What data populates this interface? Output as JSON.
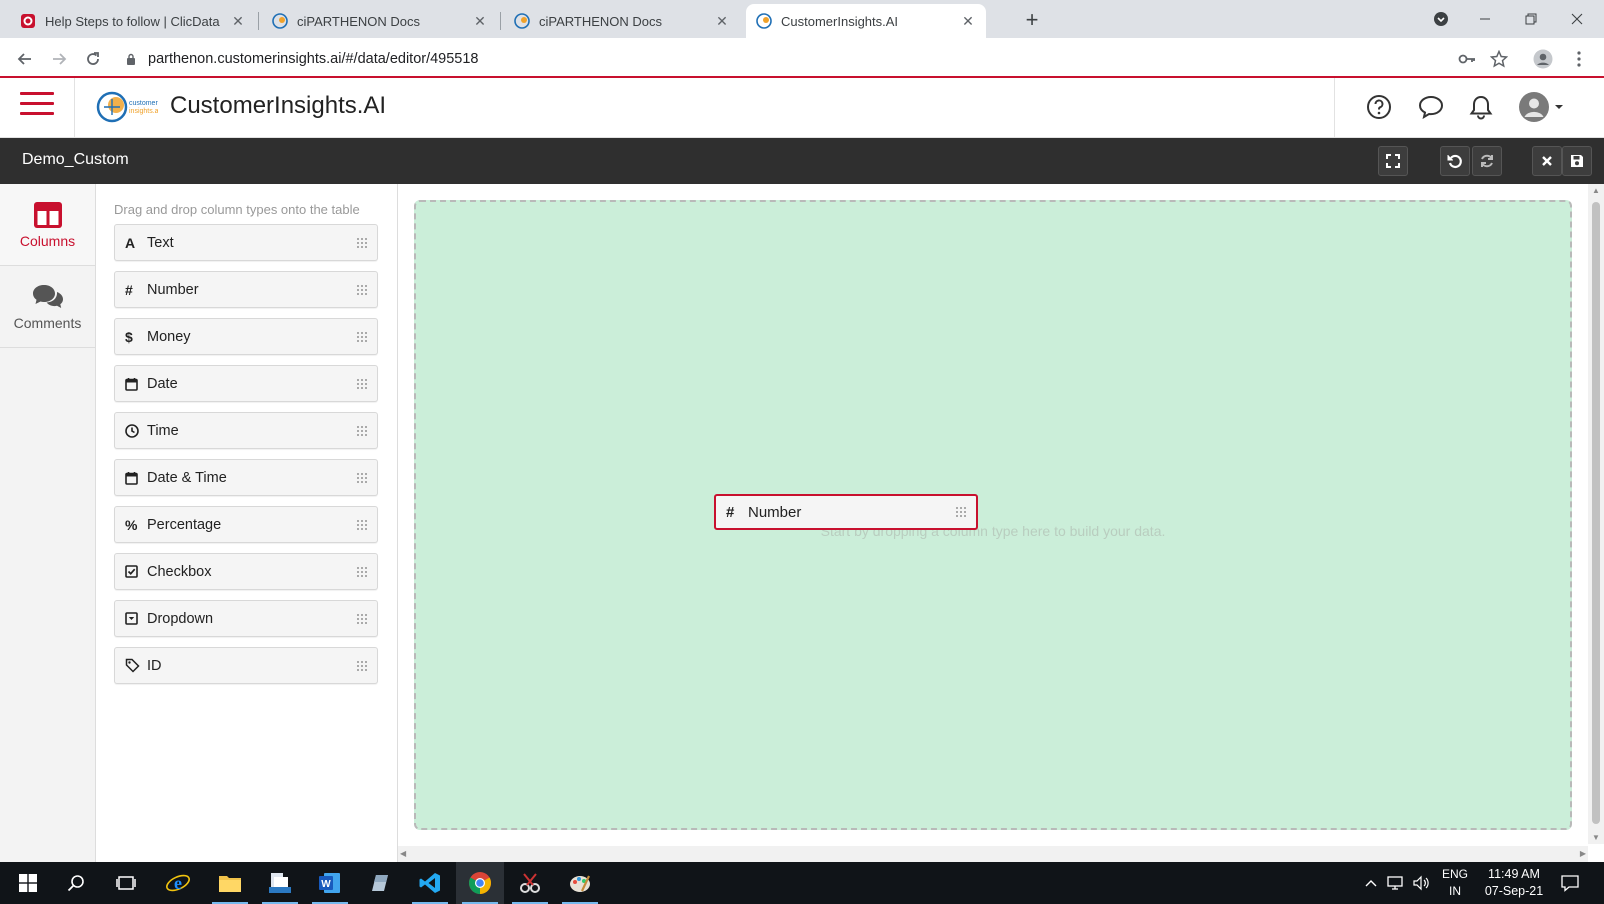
{
  "browser": {
    "tabs": [
      {
        "title": "Help Steps to follow | ClicData",
        "favicon": "clicdata-icon"
      },
      {
        "title": "ciPARTHENON Docs",
        "favicon": "parthenon-icon"
      },
      {
        "title": "ciPARTHENON Docs",
        "favicon": "parthenon-icon"
      },
      {
        "title": "CustomerInsights.AI",
        "favicon": "parthenon-icon",
        "active": true
      }
    ],
    "url": "parthenon.customerinsights.ai/#/data/editor/495518"
  },
  "app": {
    "title": "CustomerInsights.AI",
    "logo_text": "customer insights.ai",
    "accent_color": "#c8102e"
  },
  "toolbar": {
    "document_name": "Demo_Custom"
  },
  "rail": {
    "items": [
      {
        "label": "Columns",
        "icon": "columns-icon",
        "active": true
      },
      {
        "label": "Comments",
        "icon": "comments-icon",
        "active": false
      }
    ]
  },
  "panel": {
    "hint": "Drag and drop column types onto the table",
    "column_types": [
      {
        "label": "Text",
        "icon": "A"
      },
      {
        "label": "Number",
        "icon": "#"
      },
      {
        "label": "Money",
        "icon": "$"
      },
      {
        "label": "Date",
        "icon": "calendar-icon"
      },
      {
        "label": "Time",
        "icon": "clock-icon"
      },
      {
        "label": "Date & Time",
        "icon": "calendar-icon"
      },
      {
        "label": "Percentage",
        "icon": "%"
      },
      {
        "label": "Checkbox",
        "icon": "checkbox-icon"
      },
      {
        "label": "Dropdown",
        "icon": "dropdown-icon"
      },
      {
        "label": "ID",
        "icon": "tag-icon"
      }
    ]
  },
  "canvas": {
    "drop_hint": "Start by dropping a column type here to build your data.",
    "dragging": {
      "label": "Number",
      "icon": "#"
    },
    "background_color": "#cbeed9"
  },
  "taskbar": {
    "lang_line1": "ENG",
    "lang_line2": "IN",
    "time": "11:49 AM",
    "date": "07-Sep-21"
  }
}
